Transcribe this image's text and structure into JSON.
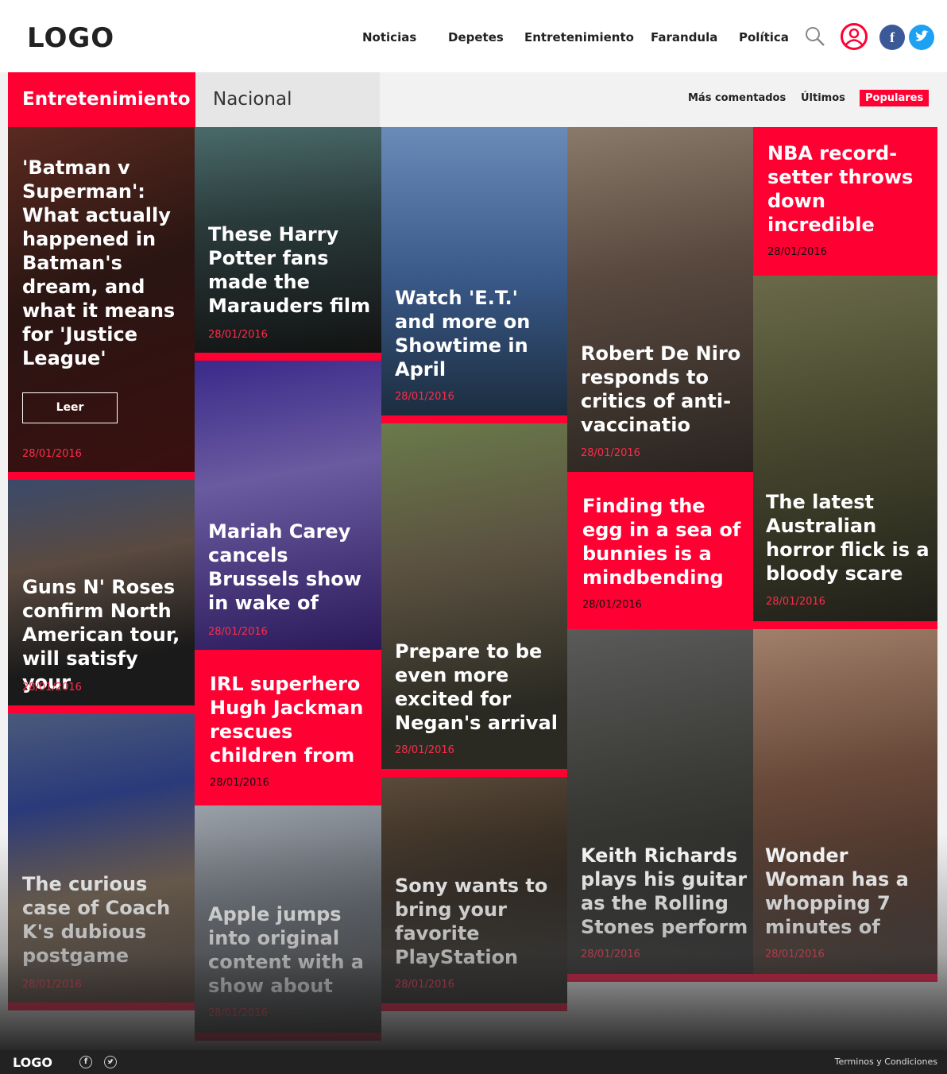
{
  "header": {
    "logo": "LOGO",
    "nav": [
      "Noticias",
      "Depetes",
      "Entretenimiento",
      "Farandula",
      "Política"
    ],
    "icons": [
      "search-icon",
      "user-icon",
      "facebook-icon",
      "twitter-icon"
    ],
    "accent": "#ff0033"
  },
  "tabs": {
    "active": "Entretenimiento",
    "inactive": "Nacional",
    "filters": [
      "Más comentados",
      "Últimos",
      "Populares"
    ],
    "selected_filter": "Populares"
  },
  "cards": [
    {
      "title": "'Batman v Superman': What actually happened in Batman's dream, and what it means for 'Justice League'",
      "date": "28/01/2016",
      "button": "Leer"
    },
    {
      "title": "Guns N' Roses confirm North American tour, will satisfy your",
      "date": "28/01/2016"
    },
    {
      "title": "The curious case of Coach K's dubious postgame",
      "date": "28/01/2016"
    },
    {
      "title": "These Harry Potter fans made the Marauders film",
      "date": "28/01/2016"
    },
    {
      "title": "Mariah Carey cancels Brussels show in wake of",
      "date": "28/01/2016"
    },
    {
      "title": "IRL superhero Hugh Jackman rescues children from",
      "date": "28/01/2016"
    },
    {
      "title": "Apple jumps into original content with a show about",
      "date": "28/01/2016"
    },
    {
      "title": "Watch 'E.T.' and more on Showtime in April",
      "date": "28/01/2016"
    },
    {
      "title": "Prepare to be even more excited for Negan's arrival",
      "date": "28/01/2016"
    },
    {
      "title": "Sony wants to bring your favorite PlayStation",
      "date": "28/01/2016"
    },
    {
      "title": "Robert De Niro responds to critics of anti-vaccinatio",
      "date": "28/01/2016"
    },
    {
      "title": "Finding the egg in a sea of bunnies is a mindbending",
      "date": "28/01/2016"
    },
    {
      "title": "Keith Richards plays his guitar as the Rolling Stones perform",
      "date": "28/01/2016"
    },
    {
      "title": "NBA record-setter throws down incredible",
      "date": "28/01/2016"
    },
    {
      "title": "The latest Australian horror flick is a bloody scare",
      "date": "28/01/2016"
    },
    {
      "title": "Wonder Woman has a whopping 7 minutes of",
      "date": "28/01/2016"
    }
  ],
  "footer": {
    "logo": "LOGO",
    "icons": [
      "facebook-icon",
      "twitter-icon"
    ],
    "terms": "Terminos y Condiciones"
  }
}
